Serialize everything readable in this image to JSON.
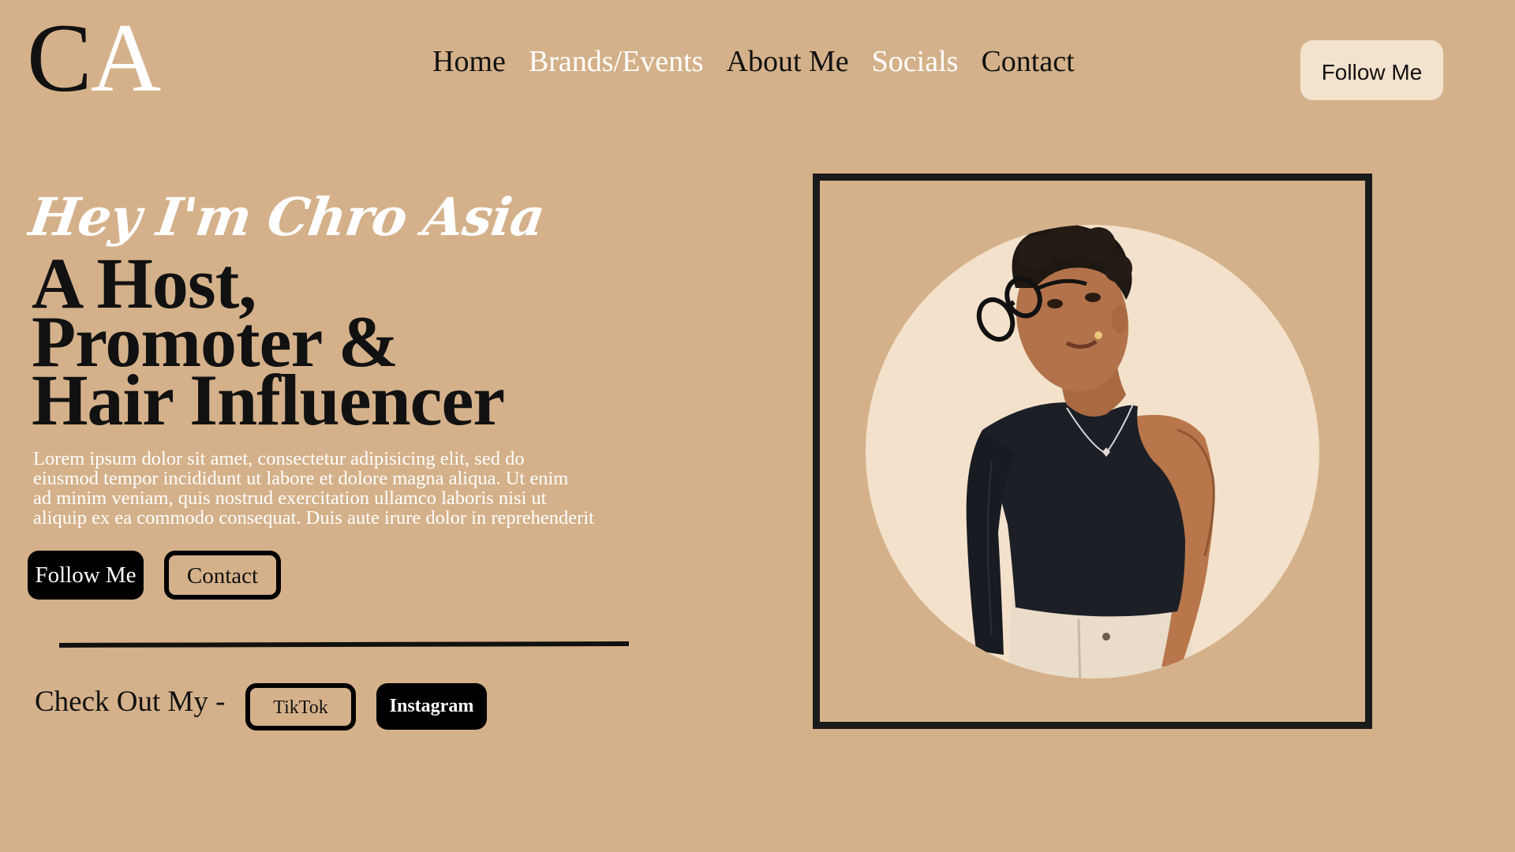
{
  "logo": {
    "first_letter": "C",
    "second_letter": "A"
  },
  "nav": {
    "items": [
      {
        "label": "Home"
      },
      {
        "label": "Brands/Events"
      },
      {
        "label": "About Me"
      },
      {
        "label": "Socials"
      },
      {
        "label": "Contact"
      }
    ],
    "follow_button": "Follow Me"
  },
  "hero": {
    "greeting": "Hey I'm Chro Asia",
    "headline": [
      "A Host,",
      "Promoter &",
      "Hair Influencer"
    ],
    "lorem_lines": [
      "Lorem ipsum dolor sit amet, consectetur adipisicing elit, sed do",
      "eiusmod tempor incididunt ut labore et dolore magna aliqua. Ut enim",
      "ad minim veniam, quis nostrud exercitation ullamco laboris nisi ut",
      "aliquip ex ea commodo consequat. Duis aute irure dolor in reprehenderit"
    ],
    "follow_button": "Follow Me",
    "contact_button": "Contact"
  },
  "socials": {
    "label": "Check Out My -",
    "tiktok": "TikTok",
    "instagram": "Instagram"
  },
  "colors": {
    "background": "#D4B18A",
    "cream": "#F3E3CE",
    "dark": "#111111",
    "white": "#FFFFFF"
  },
  "portrait": {
    "icon": "person-portrait-photo"
  }
}
